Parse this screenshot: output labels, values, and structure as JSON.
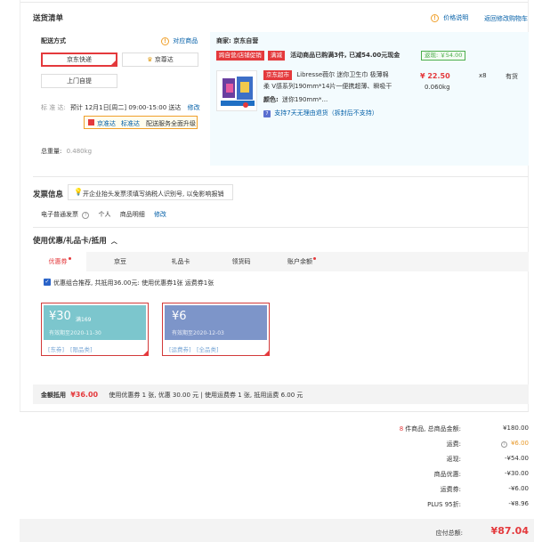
{
  "section": {
    "title": "送货清单",
    "price_note": "价格说明",
    "back_cart": "返回修改购物车"
  },
  "shipping": {
    "label": "配送方式",
    "store_goods_link": "对应商品",
    "options": [
      "京东快递",
      "京尊达",
      "上门自提"
    ],
    "std_label": "标 准 达:",
    "std_value": "预计 12月1日[周二] 09:00-15:00 送达",
    "std_edit": "修改",
    "tip_a": "京准达",
    "tip_b": "标准达",
    "tip_c": "配送服务全面升级",
    "weight_label": "总重量:",
    "weight_value": "0.480kg"
  },
  "store": {
    "merchant": "商家: 京东自营",
    "tag1": "跨自营/店铺促销",
    "tag2": "满减",
    "promo": "活动商品已购满3件, 已减54.00元现金",
    "rebate": "返现: ￥54.00",
    "supermarket_tag": "京东超市",
    "product_name_1": "Libresse薇尔 迷你卫生巾 极薄棉",
    "product_name_2": "柔 V感系列190mm*14片一便携超薄、瞬吸干",
    "price": "¥ 22.50",
    "qty": "x8",
    "stock": "有货",
    "weight": "0.060kg",
    "color_label": "颜色:",
    "color_value": "迷你190mm*...",
    "return_policy": "支持7天无理由退货（拆封后不支持）"
  },
  "invoice": {
    "title": "发票信息",
    "tip": "开企业抬头发票须填写纳税人识别号, 以免影响报销",
    "type": "电子普通发票",
    "person": "个人",
    "detail": "商品明细",
    "edit": "修改"
  },
  "discount": {
    "title": "使用优惠/礼品卡/抵用",
    "tabs": [
      "优惠券",
      "京豆",
      "礼品卡",
      "领货码",
      "账户余额"
    ],
    "combo_text": "优惠组合推荐, 共抵用36.00元: 使用优惠券1张 运费券1张",
    "coupon1": {
      "amount": "¥30",
      "cond": "满169",
      "expiry": "有效期至2020-11-30",
      "tag1": "[东券]",
      "tag2": "[限品类]"
    },
    "coupon2": {
      "amount": "¥6",
      "expiry": "有效期至2020-12-03",
      "tag1": "[运费券]",
      "tag2": "[全品类]"
    },
    "summary_label": "金额抵用",
    "summary_amount": "¥36.00",
    "summary_detail": "使用优惠券 1 张, 优惠 30.00 元  | 使用运费券 1 张, 抵用运费 6.00 元"
  },
  "totals": {
    "count": "8",
    "count_suffix": "件商品, 总商品金额:",
    "goods_amount": "¥180.00",
    "freight_label": "运费:",
    "freight_value": "¥6.00",
    "reduce_label": "返现:",
    "reduce_value": "-¥54.00",
    "coupon_label": "商品优惠:",
    "coupon_value": "-¥30.00",
    "freight_coupon_label": "运费券:",
    "freight_coupon_value": "-¥6.00",
    "plus_label": "PLUS 95折:",
    "plus_value": "-¥8.96",
    "pay_label": "应付总额:",
    "pay_value": "¥87.04"
  },
  "colors": {
    "accent_red": "#e4393c",
    "link_blue": "#005ea7",
    "coupon_teal": "#7cc6cd",
    "coupon_blue": "#7d95c9",
    "panel_bg": "#f3fbfe"
  }
}
